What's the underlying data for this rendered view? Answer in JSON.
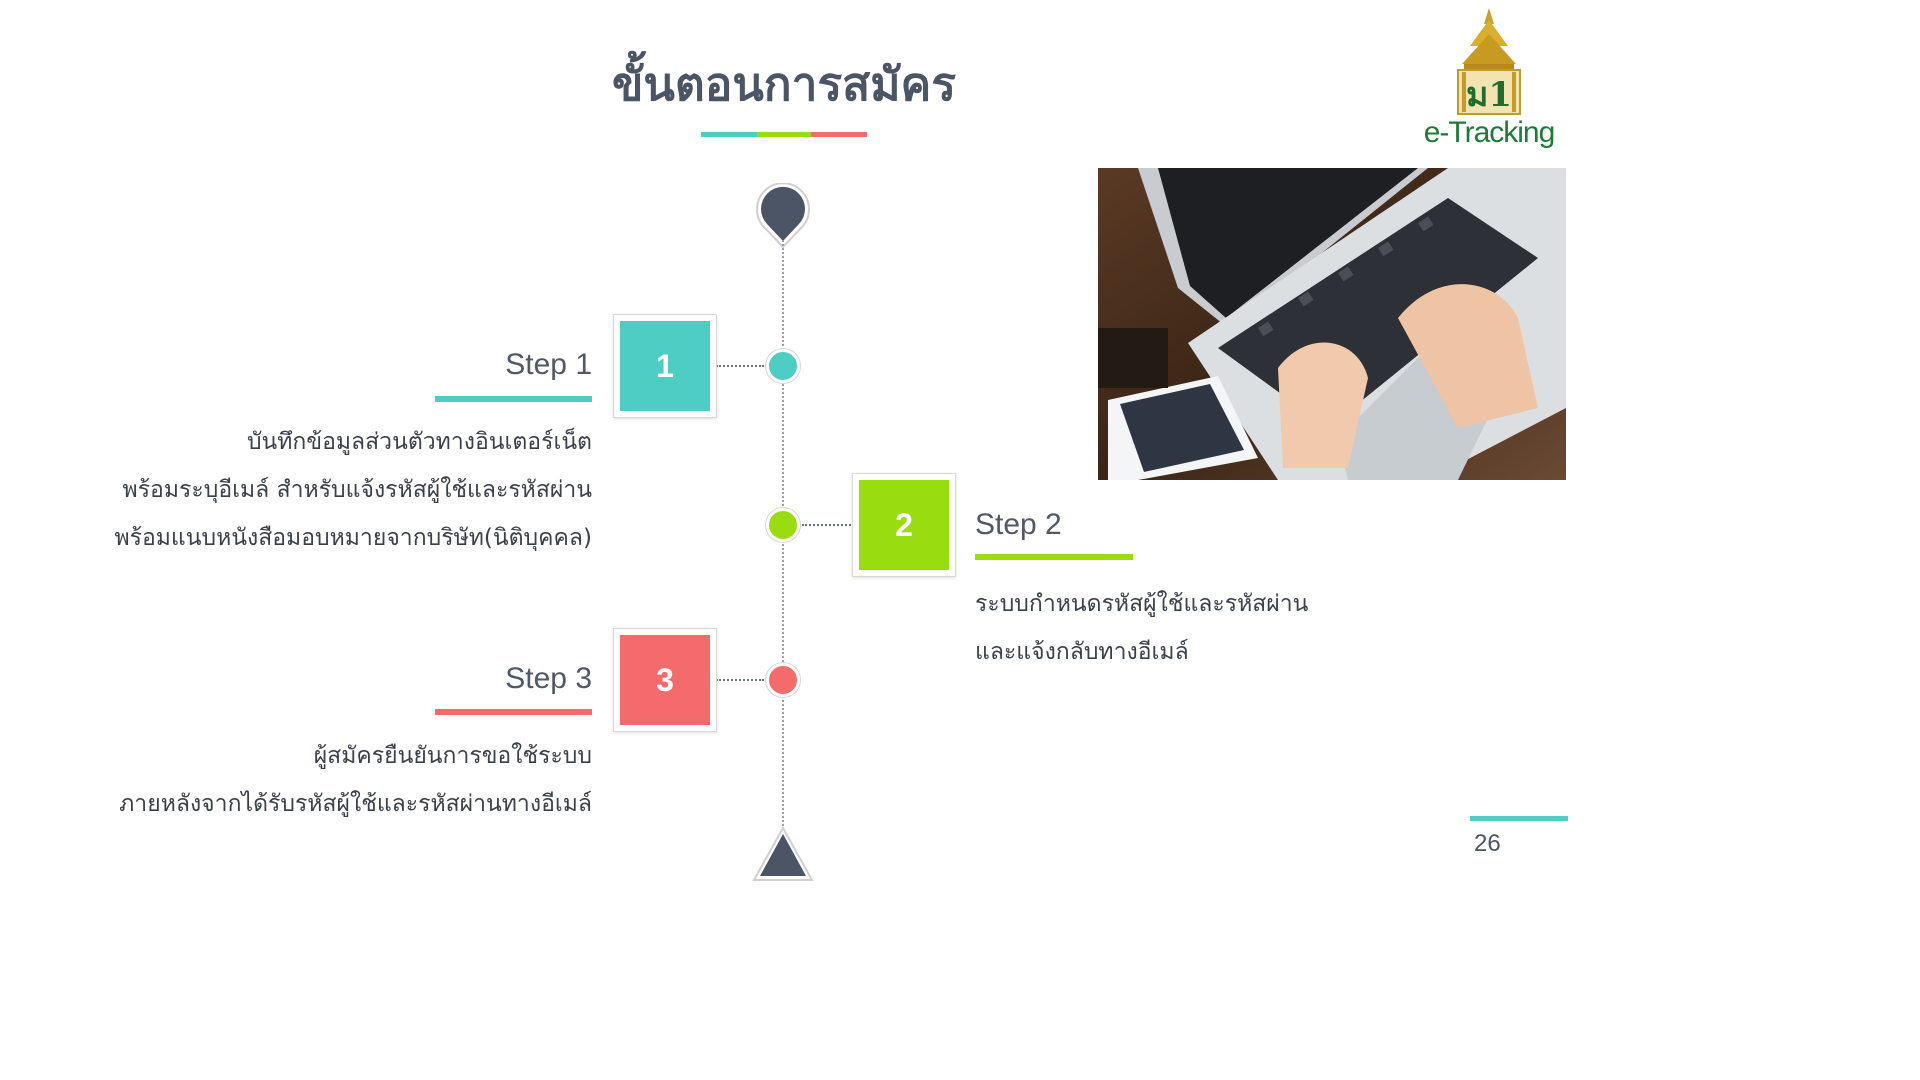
{
  "title": "ขั้นตอนการสมัคร",
  "colors": {
    "teal": "#4ecdc4",
    "green": "#99dd11",
    "red": "#f56b6b",
    "dark": "#4c5565"
  },
  "logo": {
    "text": "e-Tracking",
    "icon": "thai-pavilion-emblem-icon"
  },
  "photo": {
    "icon": "laptop-typing-photo"
  },
  "steps": [
    {
      "label": "Step 1",
      "number": "1",
      "lines": [
        "บันทึกข้อมูลส่วนตัวทางอินเตอร์เน็ต",
        "พร้อมระบุอีเมล์ สำหรับแจ้งรหัสผู้ใช้และรหัสผ่าน",
        "พร้อมแนบหนังสือมอบหมายจากบริษัท(นิติบุคคล)"
      ]
    },
    {
      "label": "Step 2",
      "number": "2",
      "lines": [
        "ระบบกำหนดรหัสผู้ใช้และรหัสผ่าน",
        "และแจ้งกลับทางอีเมล์"
      ]
    },
    {
      "label": "Step 3",
      "number": "3",
      "lines": [
        "ผู้สมัครยืนยันการขอใช้ระบบ",
        "ภายหลังจากได้รับรหัสผู้ใช้และรหัสผ่านทางอีเมล์"
      ]
    }
  ],
  "page_number": "26"
}
